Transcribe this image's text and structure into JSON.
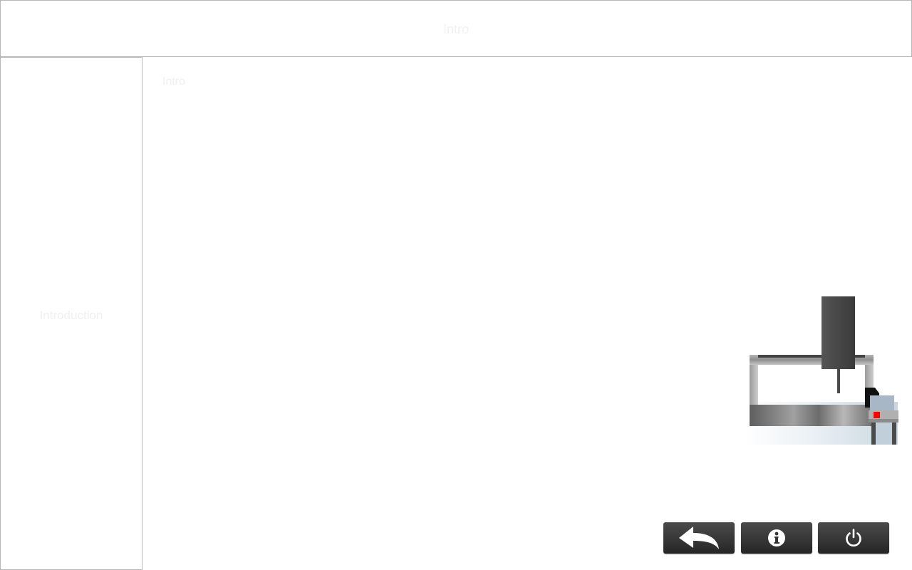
{
  "header": {
    "title": "Intro"
  },
  "sidebar": {
    "label": "Introduction"
  },
  "main": {
    "heading": "Intro"
  },
  "toolbar": {
    "buttons": [
      {
        "icon": "back-arrow-icon"
      },
      {
        "icon": "info-icon"
      },
      {
        "icon": "power-icon"
      }
    ]
  },
  "colors": {
    "border": "#b8b8b8",
    "button_dark": "#333333",
    "indicator_red": "#ff0000"
  }
}
